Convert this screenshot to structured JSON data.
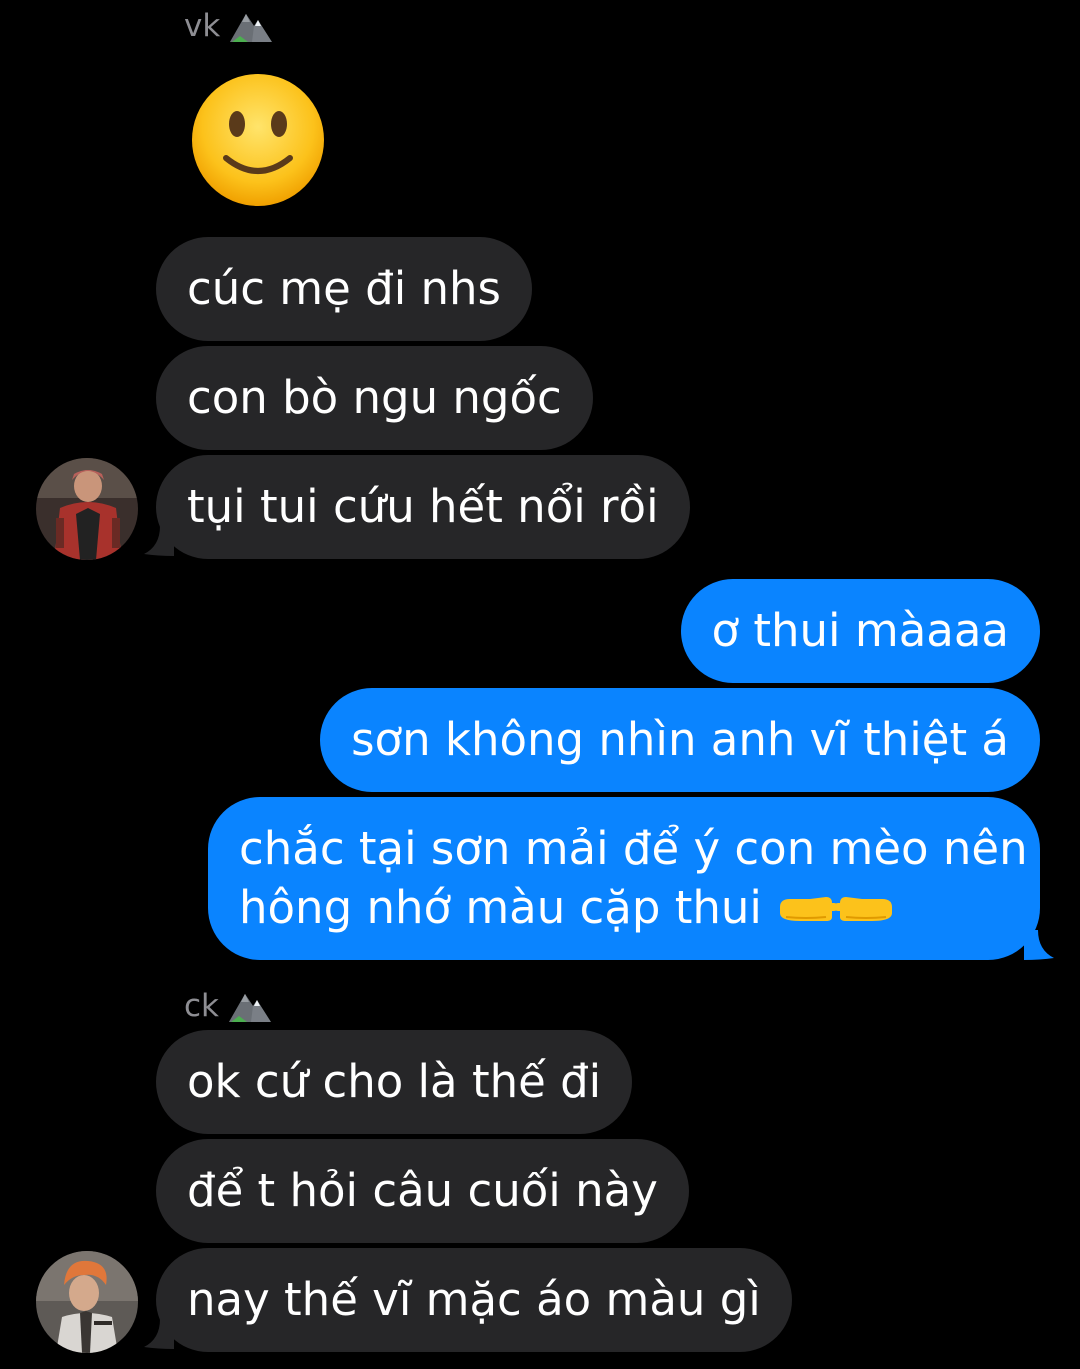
{
  "thread": {
    "sender_top": "vk",
    "sender_bottom": "ck",
    "messages_in_1": [
      "cúc mẹ đi nhs",
      "con bò ngu ngốc",
      "tụi tui cứu hết nổi rồi"
    ],
    "messages_out": [
      "ơ thui màaaa",
      "sơn không nhìn anh vĩ thiệt á",
      "chắc tại sơn mải để ý con mèo nên",
      "hông nhớ màu cặp thui"
    ],
    "messages_in_2": [
      "ok cứ cho là thế đi",
      "để t hỏi câu cuối này",
      "nay thế vĩ mặc áo màu gì"
    ]
  },
  "icons": {
    "sender_badge": "mountain-emoji-icon",
    "big_emoji": "slightly-smiling-face-emoji-icon",
    "inline_emoji": "pointing-fingers-emoji-icon"
  },
  "colors": {
    "incoming_bubble": "#262628",
    "outgoing_bubble": "#0a84ff",
    "background": "#000000",
    "sender_label": "#8e8e93"
  }
}
